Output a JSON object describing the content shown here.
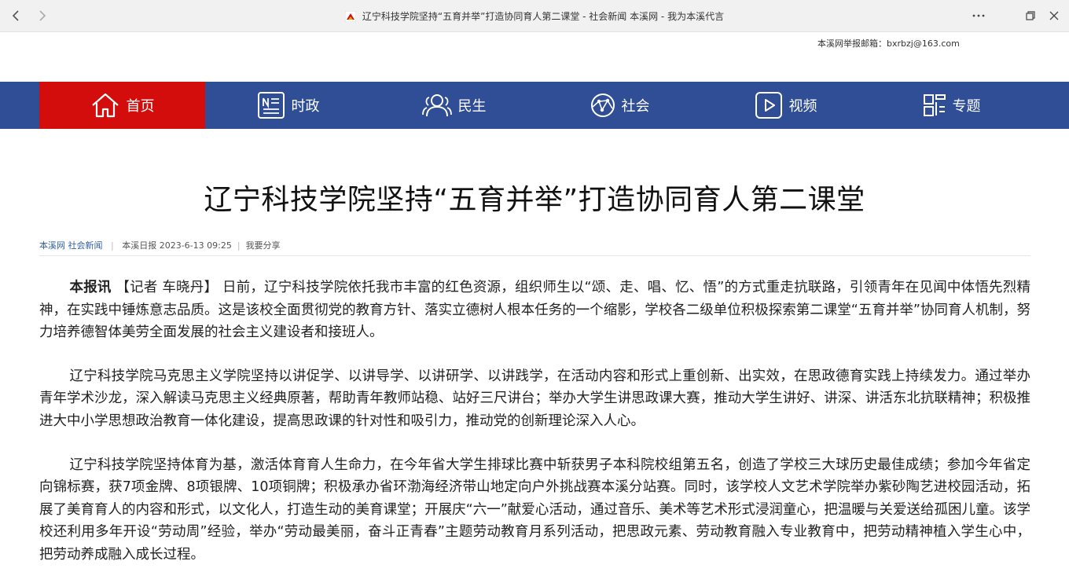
{
  "browser": {
    "tab_title": "辽宁科技学院坚持“五育并举”打造协同育人第二课堂 - 社会新闻 本溪网 - 我为本溪代言",
    "more_icon": "more-horizontal-icon",
    "accent": "#d20d0c"
  },
  "topbar": {
    "report_email": "本溪网举报邮箱：bxrbzj@163.com"
  },
  "nav": {
    "items": [
      {
        "label": "首页",
        "icon": "home-icon",
        "active": true
      },
      {
        "label": "时政",
        "icon": "newspaper-icon"
      },
      {
        "label": "民生",
        "icon": "people-icon"
      },
      {
        "label": "社会",
        "icon": "network-icon"
      },
      {
        "label": "视频",
        "icon": "video-icon"
      },
      {
        "label": "专题",
        "icon": "grid-icon"
      }
    ],
    "bg_color": "#2f4e95",
    "active_color": "#d20d0c"
  },
  "article": {
    "title": "辽宁科技学院坚持“五育并举”打造协同育人第二课堂",
    "source_site": "本溪网",
    "section": "社会新闻",
    "source_paper": "本溪日报",
    "date": "2023-6-13 09:25",
    "share": "我要分享",
    "lead_bold": "本报讯",
    "byline": "【记者 车晓丹】",
    "p1": "日前，辽宁科技学院依托我市丰富的红色资源，组织师生以“颂、走、唱、忆、悟”的方式重走抗联路，引领青年在见闻中体悟先烈精神，在实践中锤炼意志品质。这是该校全面贯彻党的教育方针、落实立德树人根本任务的一个缩影，学校各二级单位积极探索第二课堂“五育并举”协同育人机制，努力培养德智体美劳全面发展的社会主义建设者和接班人。",
    "p2": "辽宁科技学院马克思主义学院坚持以讲促学、以讲导学、以讲研学、以讲践学，在活动内容和形式上重创新、出实效，在思政德育实践上持续发力。通过举办青年学术沙龙，深入解读马克思主义经典原著，帮助青年教师站稳、站好三尺讲台；举办大学生讲思政课大赛，推动大学生讲好、讲深、讲活东北抗联精神；积极推进大中小学思想政治教育一体化建设，提高思政课的针对性和吸引力，推动党的创新理论深入人心。",
    "p3": "辽宁科技学院坚持体育为基，激活体育育人生命力，在今年省大学生排球比赛中斩获男子本科院校组第五名，创造了学校三大球历史最佳成绩；参加今年省定向锦标赛，获7项金牌、8项银牌、10项铜牌；积极承办省环渤海经济带山地定向户外挑战赛本溪分站赛。同时，该学校人文艺术学院举办紫砂陶艺进校园活动，拓展了美育育人的内容和形式，以文化人，打造生动的美育课堂；开展庆“六一”献爱心活动，通过音乐、美术等艺术形式浸润童心，把温暖与关爱送给孤困儿童。该学校还利用多年开设“劳动周”经验，举办“劳动最美丽，奋斗正青春”主题劳动教育月系列活动，把思政元素、劳动教育融入专业教育中，把劳动精神植入学生心中，把劳动养成融入成长过程。"
  }
}
